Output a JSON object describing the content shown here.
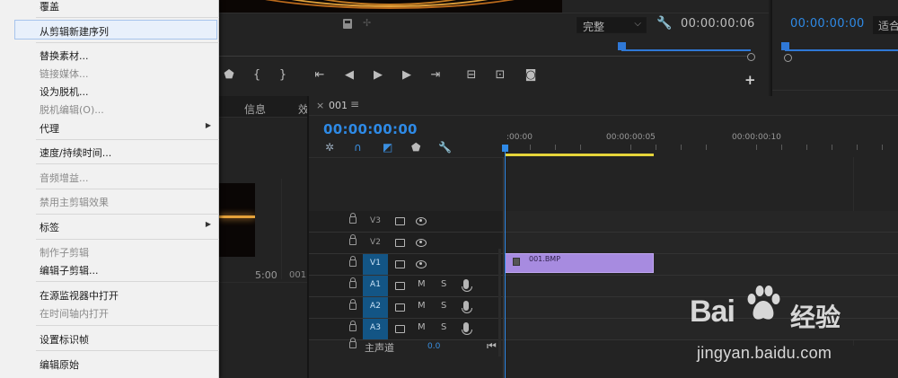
{
  "context_menu": {
    "items": [
      {
        "label": "覆盖",
        "disabled": false
      },
      {
        "label": "从剪辑新建序列",
        "disabled": false,
        "highlighted": true
      },
      {
        "label": "替换素材...",
        "disabled": false
      },
      {
        "label": "链接媒体...",
        "disabled": true
      },
      {
        "label": "设为脱机...",
        "disabled": false
      },
      {
        "label": "脱机编辑(O)...",
        "disabled": true
      },
      {
        "label": "代理",
        "disabled": false,
        "submenu": true
      },
      {
        "label": "速度/持续时间...",
        "disabled": false
      },
      {
        "label": "音频增益...",
        "disabled": true
      },
      {
        "label": "禁用主剪辑效果",
        "disabled": true
      },
      {
        "label": "标签",
        "disabled": false,
        "submenu": true
      },
      {
        "label": "制作子剪辑",
        "disabled": true
      },
      {
        "label": "编辑子剪辑...",
        "disabled": false
      },
      {
        "label": "在源监视器中打开",
        "disabled": false
      },
      {
        "label": "在时间轴内打开",
        "disabled": true
      },
      {
        "label": "设置标识帧",
        "disabled": false
      },
      {
        "label": "编辑原始",
        "disabled": false
      }
    ],
    "submenu_arrow": "▶"
  },
  "program_monitor": {
    "quality": "完整",
    "quality_arrow": "⌵",
    "timecode": "00:00:00:06",
    "transport_icons": [
      "marker-icon",
      "mark-in-icon",
      "mark-out-icon",
      "go-to-in-icon",
      "step-back-icon",
      "play-icon",
      "step-forward-icon",
      "go-to-out-icon",
      "insert-icon",
      "overwrite-icon",
      "export-frame-icon"
    ],
    "add_button": "+"
  },
  "source_monitor": {
    "timecode": "00:00:00:00",
    "fit": "适合"
  },
  "project_panel": {
    "tab_info": "信息",
    "tab_more": "效",
    "thumb_duration": "5:00",
    "thumb_name": "001"
  },
  "timeline": {
    "close": "×",
    "sequence_name": "001",
    "menu": "≡",
    "timecode": "00:00:00:00",
    "ruler": [
      ":00:00",
      "00:00:00:05",
      "00:00:00:10"
    ],
    "video_tracks": [
      {
        "name": "V3",
        "active": false
      },
      {
        "name": "V2",
        "active": false
      },
      {
        "name": "V1",
        "active": true,
        "source": "V1"
      }
    ],
    "audio_tracks": [
      {
        "name": "A1",
        "m": "M",
        "s": "S"
      },
      {
        "name": "A2",
        "m": "M",
        "s": "S"
      },
      {
        "name": "A3",
        "m": "M",
        "s": "S"
      }
    ],
    "clip": {
      "name": "001.BMP",
      "color": "#a78be0"
    },
    "master": {
      "label": "主声道",
      "value": "0.0"
    }
  },
  "watermark": {
    "logo": "Bai",
    "logo_suffix": "经验",
    "url": "jingyan.baidu.com"
  }
}
